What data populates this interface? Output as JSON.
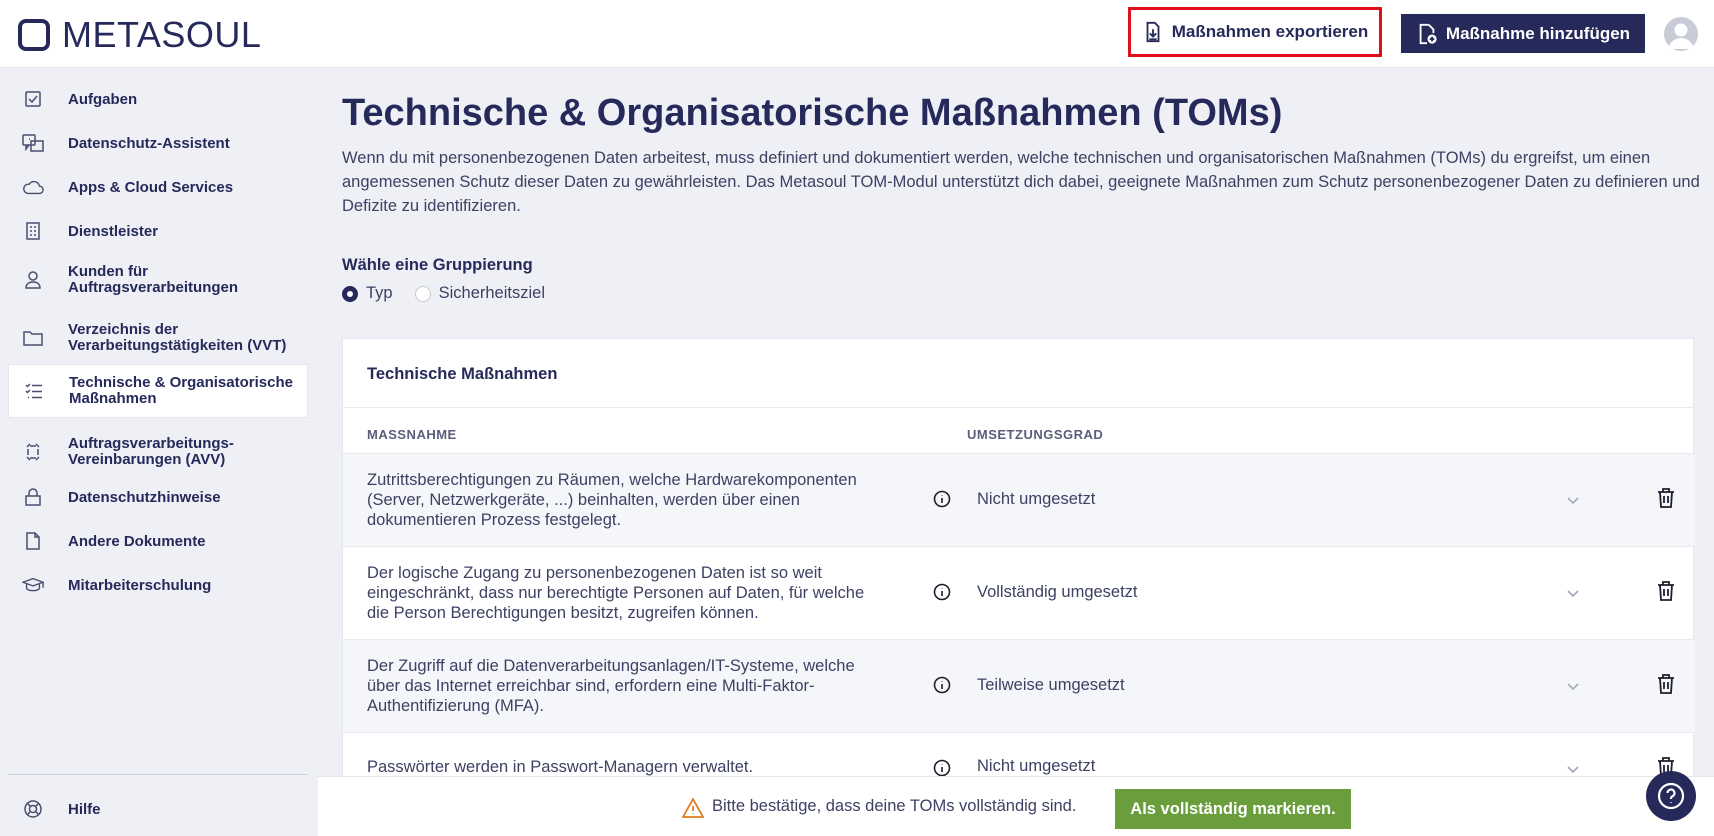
{
  "header": {
    "logo_text": "METASOUL",
    "export_label": "Maßnahmen exportieren",
    "add_label": "Maßnahme hinzufügen"
  },
  "sidebar": {
    "items": [
      {
        "label": "Aufgaben",
        "icon": "checkbox-icon"
      },
      {
        "label": "Datenschutz-Assistent",
        "icon": "assistant-icon"
      },
      {
        "label": "Apps & Cloud Services",
        "icon": "cloud-icon"
      },
      {
        "label": "Dienstleister",
        "icon": "building-icon"
      },
      {
        "label": "Kunden für\nAuftragsverarbeitungen",
        "icon": "person-icon"
      },
      {
        "label": "Verzeichnis der\nVerarbeitungstätigkeiten (VVT)",
        "icon": "folder-icon"
      },
      {
        "label": "Technische & Organisatorische\nMaßnahmen",
        "icon": "checklist-icon",
        "active": true
      },
      {
        "label": "Auftragsverarbeitungs-\nVereinbarungen (AVV)",
        "icon": "contract-icon"
      },
      {
        "label": "Datenschutzhinweise",
        "icon": "lock-icon"
      },
      {
        "label": "Andere Dokumente",
        "icon": "document-icon"
      },
      {
        "label": "Mitarbeiterschulung",
        "icon": "graduation-cap-icon"
      }
    ],
    "help_label": "Hilfe"
  },
  "main": {
    "title": "Technische & Organisatorische Maßnahmen (TOMs)",
    "intro": "Wenn du mit personenbezogenen Daten arbeitest, muss definiert und dokumentiert werden, welche technischen und organisatorischen Maßnahmen (TOMs) du ergreifst, um einen angemessenen Schutz dieser Daten zu gewährleisten. Das Metasoul TOM-Modul unterstützt dich dabei, geeignete Maßnahmen zum Schutz personenbezogener Daten zu definieren und Defizite zu identifizieren.",
    "grouping_label": "Wähle eine Gruppierung",
    "grouping_options": [
      "Typ",
      "Sicherheitsziel"
    ],
    "grouping_selected": "Typ",
    "card": {
      "title": "Technische Maßnahmen",
      "col_measure": "MASSNAHME",
      "col_status": "UMSETZUNGSGRAD",
      "rows": [
        {
          "text": "Zutrittsberechtigungen zu Räumen, welche Hardwarekomponenten (Server, Netzwerkgeräte, ...) beinhalten, werden über einen dokumentieren Prozess festgelegt.",
          "status": "Nicht umgesetzt"
        },
        {
          "text": "Der logische Zugang zu personenbezogenen Daten ist so weit eingeschränkt, dass nur berechtigte Personen auf Daten, für welche die Person Berechtigungen besitzt, zugreifen können.",
          "status": "Vollständig umgesetzt"
        },
        {
          "text": "Der Zugriff auf die Datenverarbeitungsanlagen/IT-Systeme, welche über das Internet erreichbar sind, erfordern eine Multi-Faktor-Authentifizierung (MFA).",
          "status": "Teilweise umgesetzt"
        },
        {
          "text": "Passwörter werden in Passwort-Managern verwaltet.",
          "status": "Nicht umgesetzt"
        }
      ]
    }
  },
  "bottombar": {
    "warning_text": "Bitte bestätige, dass deine TOMs vollständig sind.",
    "complete_label": "Als vollständig markieren."
  },
  "colors": {
    "brand": "#262a5a",
    "highlight": "#e0101a",
    "success": "#6a9e3c",
    "warning": "#e07a1f"
  }
}
